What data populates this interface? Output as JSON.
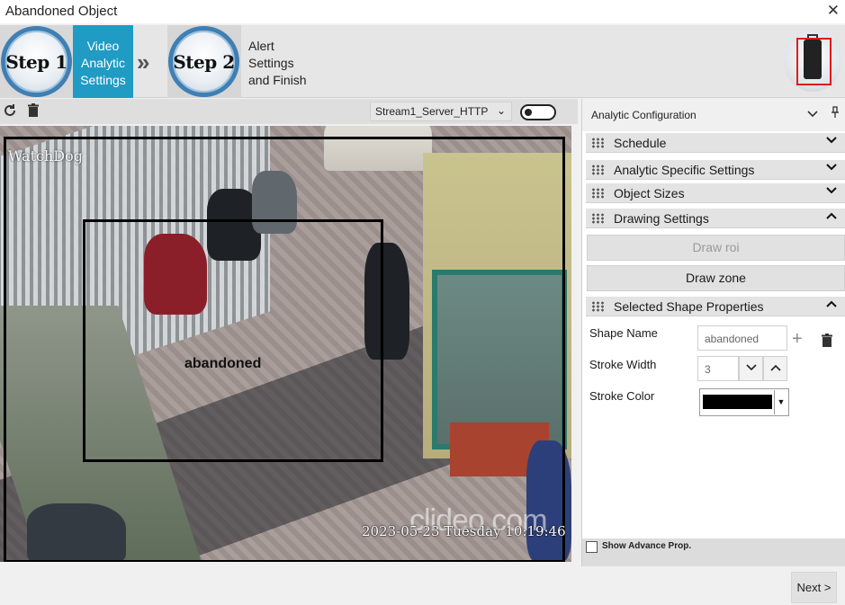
{
  "window": {
    "title": "Abandoned Object",
    "close_glyph": "✕"
  },
  "wizard": {
    "step1": {
      "badge": "Step 1",
      "label": "Video Analytic Settings"
    },
    "separator_glyph": "»",
    "step2": {
      "badge": "Step 2",
      "label": "Alert Settings and Finish"
    },
    "accent_color": "#1f9bc4"
  },
  "toolbar": {
    "refresh_icon": "refresh-icon",
    "delete_icon": "trash-icon",
    "stream": {
      "selected": "Stream1_Server_HTTP",
      "chevron": "⌄"
    },
    "toggle_on": false
  },
  "video": {
    "overlay_top_left": "WatchDog",
    "watermark": "clideo.com",
    "timestamp": "2023-05-23 Tuesday 10:19:46",
    "zone_label": "abandoned",
    "stroke_color": "#000000"
  },
  "panel": {
    "title": "Analytic Configuration",
    "sections": [
      {
        "label": "Schedule",
        "state": "collapsed",
        "chevron": "⌄"
      },
      {
        "label": "Analytic Specific Settings",
        "state": "collapsed",
        "chevron": "⌄"
      },
      {
        "label": "Object Sizes",
        "state": "collapsed",
        "chevron": "⌄"
      },
      {
        "label": "Drawing Settings",
        "state": "expanded",
        "chevron": "⌃"
      },
      {
        "label": "Selected Shape Properties",
        "state": "expanded",
        "chevron": "⌃"
      }
    ],
    "draw_roi": "Draw roi",
    "draw_zone": "Draw zone",
    "shape": {
      "name_label": "Shape Name",
      "name_value": "abandoned",
      "stroke_width_label": "Stroke Width",
      "stroke_width_value": "3",
      "stroke_color_label": "Stroke Color",
      "stroke_color_value": "#000000",
      "add_glyph": "+",
      "dec_glyph": "⌄",
      "inc_glyph": "⌃",
      "dropdown_glyph": "▼"
    },
    "advance": {
      "label": "Show Advance Prop.",
      "checked": false
    }
  },
  "footer": {
    "next_label": "Next >"
  }
}
